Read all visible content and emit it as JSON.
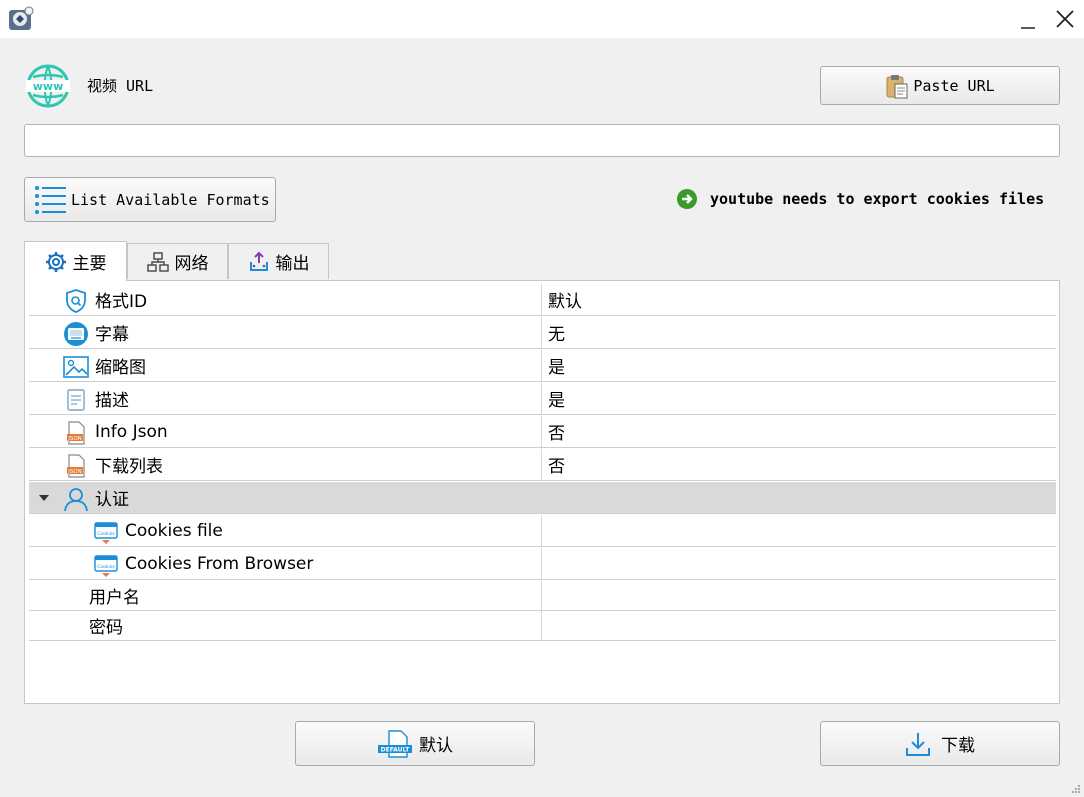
{
  "window": {
    "minimize_icon": "minimize-icon",
    "close_icon": "close-icon"
  },
  "url_section": {
    "label": "视频 URL",
    "input_value": "",
    "paste_button": "Paste URL"
  },
  "formats_button": "List Available Formats",
  "notice": "youtube needs to export cookies files",
  "tabs": [
    {
      "label": "主要",
      "icon": "gear-icon"
    },
    {
      "label": "网络",
      "icon": "network-icon"
    },
    {
      "label": "输出",
      "icon": "output-icon"
    }
  ],
  "properties": [
    {
      "label": "格式ID",
      "value": "默认",
      "icon": "shield-search-icon"
    },
    {
      "label": "字幕",
      "value": "无",
      "icon": "subtitle-icon"
    },
    {
      "label": "缩略图",
      "value": "是",
      "icon": "image-icon"
    },
    {
      "label": "描述",
      "value": "是",
      "icon": "notepad-icon"
    },
    {
      "label": "Info Json",
      "value": "否",
      "icon": "json-file-icon"
    },
    {
      "label": "下载列表",
      "value": "否",
      "icon": "json-file-icon"
    }
  ],
  "auth": {
    "label": "认证",
    "icon": "user-icon",
    "items": [
      {
        "label": "Cookies file",
        "value": "",
        "icon": "cookies-icon"
      },
      {
        "label": "Cookies From Browser",
        "value": "",
        "icon": "cookies-icon"
      },
      {
        "label": "用户名",
        "value": ""
      },
      {
        "label": "密码",
        "value": ""
      }
    ]
  },
  "footer": {
    "default_button": "默认",
    "default_badge": "DEFAULT",
    "download_button": "下载"
  },
  "colors": {
    "accent": "#1a8fd8",
    "globe": "#2cc6b3",
    "notice_icon": "#3a9a2a",
    "json_orange": "#e37b3d",
    "group_bg": "#d9d9d9"
  }
}
